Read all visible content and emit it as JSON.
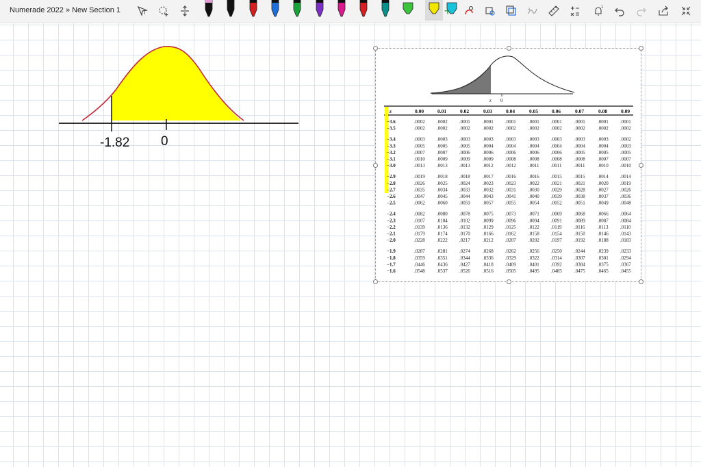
{
  "app": {
    "breadcrumb": "Numerade 2022 » New Section 1"
  },
  "toolbar": {
    "icons": [
      "lasso-select-icon",
      "lasso-shape-icon",
      "insert-space-icon",
      "eraser-icon",
      "redo-icon"
    ],
    "pens": [
      {
        "name": "pen-black",
        "color": "#111111"
      },
      {
        "name": "pen-black-2",
        "color": "#111111"
      },
      {
        "name": "pen-red",
        "color": "#d32020"
      },
      {
        "name": "pen-blue",
        "color": "#1e6fd9"
      },
      {
        "name": "pen-green",
        "color": "#19a33a"
      },
      {
        "name": "pen-purple",
        "color": "#7b2fc4"
      },
      {
        "name": "pen-magenta",
        "color": "#d81b8c"
      },
      {
        "name": "pen-red-2",
        "color": "#d32020"
      },
      {
        "name": "pen-teal",
        "color": "#0b8f8a"
      },
      {
        "name": "highlighter-green",
        "color": "#3dc43d"
      },
      {
        "name": "highlighter-yellow",
        "color": "#f2e600"
      },
      {
        "name": "highlighter-cyan",
        "color": "#19c3d9"
      }
    ],
    "add_label": "+"
  },
  "sketch": {
    "axis_labels": [
      "-1.82",
      "0"
    ],
    "fill_color": "#ffff00",
    "curve_color": "#c0283a"
  },
  "z_table": {
    "figure_labels": [
      "z",
      "0"
    ],
    "columns": [
      "z",
      "0.00",
      "0.01",
      "0.02",
      "0.03",
      "0.04",
      "0.05",
      "0.06",
      "0.07",
      "0.08",
      "0.09"
    ],
    "groups": [
      [
        [
          "−3.6",
          ".0002",
          ".0002",
          ".0001",
          ".0001",
          ".0001",
          ".0001",
          ".0001",
          ".0001",
          ".0001",
          ".0001"
        ],
        [
          "−3.5",
          ".0002",
          ".0002",
          ".0002",
          ".0002",
          ".0002",
          ".0002",
          ".0002",
          ".0002",
          ".0002",
          ".0002"
        ]
      ],
      [
        [
          "−3.4",
          ".0003",
          ".0003",
          ".0003",
          ".0003",
          ".0003",
          ".0003",
          ".0003",
          ".0003",
          ".0003",
          ".0002"
        ],
        [
          "−3.3",
          ".0005",
          ".0005",
          ".0005",
          ".0004",
          ".0004",
          ".0004",
          ".0004",
          ".0004",
          ".0004",
          ".0003"
        ],
        [
          "−3.2",
          ".0007",
          ".0007",
          ".0006",
          ".0006",
          ".0006",
          ".0006",
          ".0006",
          ".0005",
          ".0005",
          ".0005"
        ],
        [
          "−3.1",
          ".0010",
          ".0009",
          ".0009",
          ".0009",
          ".0008",
          ".0008",
          ".0008",
          ".0008",
          ".0007",
          ".0007"
        ],
        [
          "−3.0",
          ".0013",
          ".0013",
          ".0013",
          ".0012",
          ".0012",
          ".0011",
          ".0011",
          ".0011",
          ".0010",
          ".0010"
        ]
      ],
      [
        [
          "−2.9",
          ".0019",
          ".0018",
          ".0018",
          ".0017",
          ".0016",
          ".0016",
          ".0015",
          ".0015",
          ".0014",
          ".0014"
        ],
        [
          "−2.8",
          ".0026",
          ".0025",
          ".0024",
          ".0023",
          ".0023",
          ".0022",
          ".0021",
          ".0021",
          ".0020",
          ".0019"
        ],
        [
          "−2.7",
          ".0035",
          ".0034",
          ".0033",
          ".0032",
          ".0031",
          ".0030",
          ".0029",
          ".0028",
          ".0027",
          ".0026"
        ],
        [
          "−2.6",
          ".0047",
          ".0045",
          ".0044",
          ".0043",
          ".0041",
          ".0040",
          ".0039",
          ".0038",
          ".0037",
          ".0036"
        ],
        [
          "−2.5",
          ".0062",
          ".0060",
          ".0059",
          ".0057",
          ".0055",
          ".0054",
          ".0052",
          ".0051",
          ".0049",
          ".0048"
        ]
      ],
      [
        [
          "−2.4",
          ".0082",
          ".0080",
          ".0078",
          ".0075",
          ".0073",
          ".0071",
          ".0069",
          ".0068",
          ".0066",
          ".0064"
        ],
        [
          "−2.3",
          ".0107",
          ".0104",
          ".0102",
          ".0099",
          ".0096",
          ".0094",
          ".0091",
          ".0089",
          ".0087",
          ".0084"
        ],
        [
          "−2.2",
          ".0139",
          ".0136",
          ".0132",
          ".0129",
          ".0125",
          ".0122",
          ".0119",
          ".0116",
          ".0113",
          ".0110"
        ],
        [
          "−2.1",
          ".0179",
          ".0174",
          ".0170",
          ".0166",
          ".0162",
          ".0158",
          ".0154",
          ".0150",
          ".0146",
          ".0143"
        ],
        [
          "−2.0",
          ".0228",
          ".0222",
          ".0217",
          ".0212",
          ".0207",
          ".0202",
          ".0197",
          ".0192",
          ".0188",
          ".0183"
        ]
      ],
      [
        [
          "−1.9",
          ".0287",
          ".0281",
          ".0274",
          ".0268",
          ".0262",
          ".0256",
          ".0250",
          ".0244",
          ".0239",
          ".0233"
        ],
        [
          "−1.8",
          ".0359",
          ".0351",
          ".0344",
          ".0336",
          ".0329",
          ".0322",
          ".0314",
          ".0307",
          ".0301",
          ".0294"
        ],
        [
          "−1.7",
          ".0446",
          ".0436",
          ".0427",
          ".0418",
          ".0409",
          ".0401",
          ".0392",
          ".0384",
          ".0375",
          ".0367"
        ],
        [
          "−1.6",
          ".0548",
          ".0537",
          ".0526",
          ".0516",
          ".0505",
          ".0495",
          ".0485",
          ".0475",
          ".0465",
          ".0455"
        ]
      ]
    ]
  }
}
